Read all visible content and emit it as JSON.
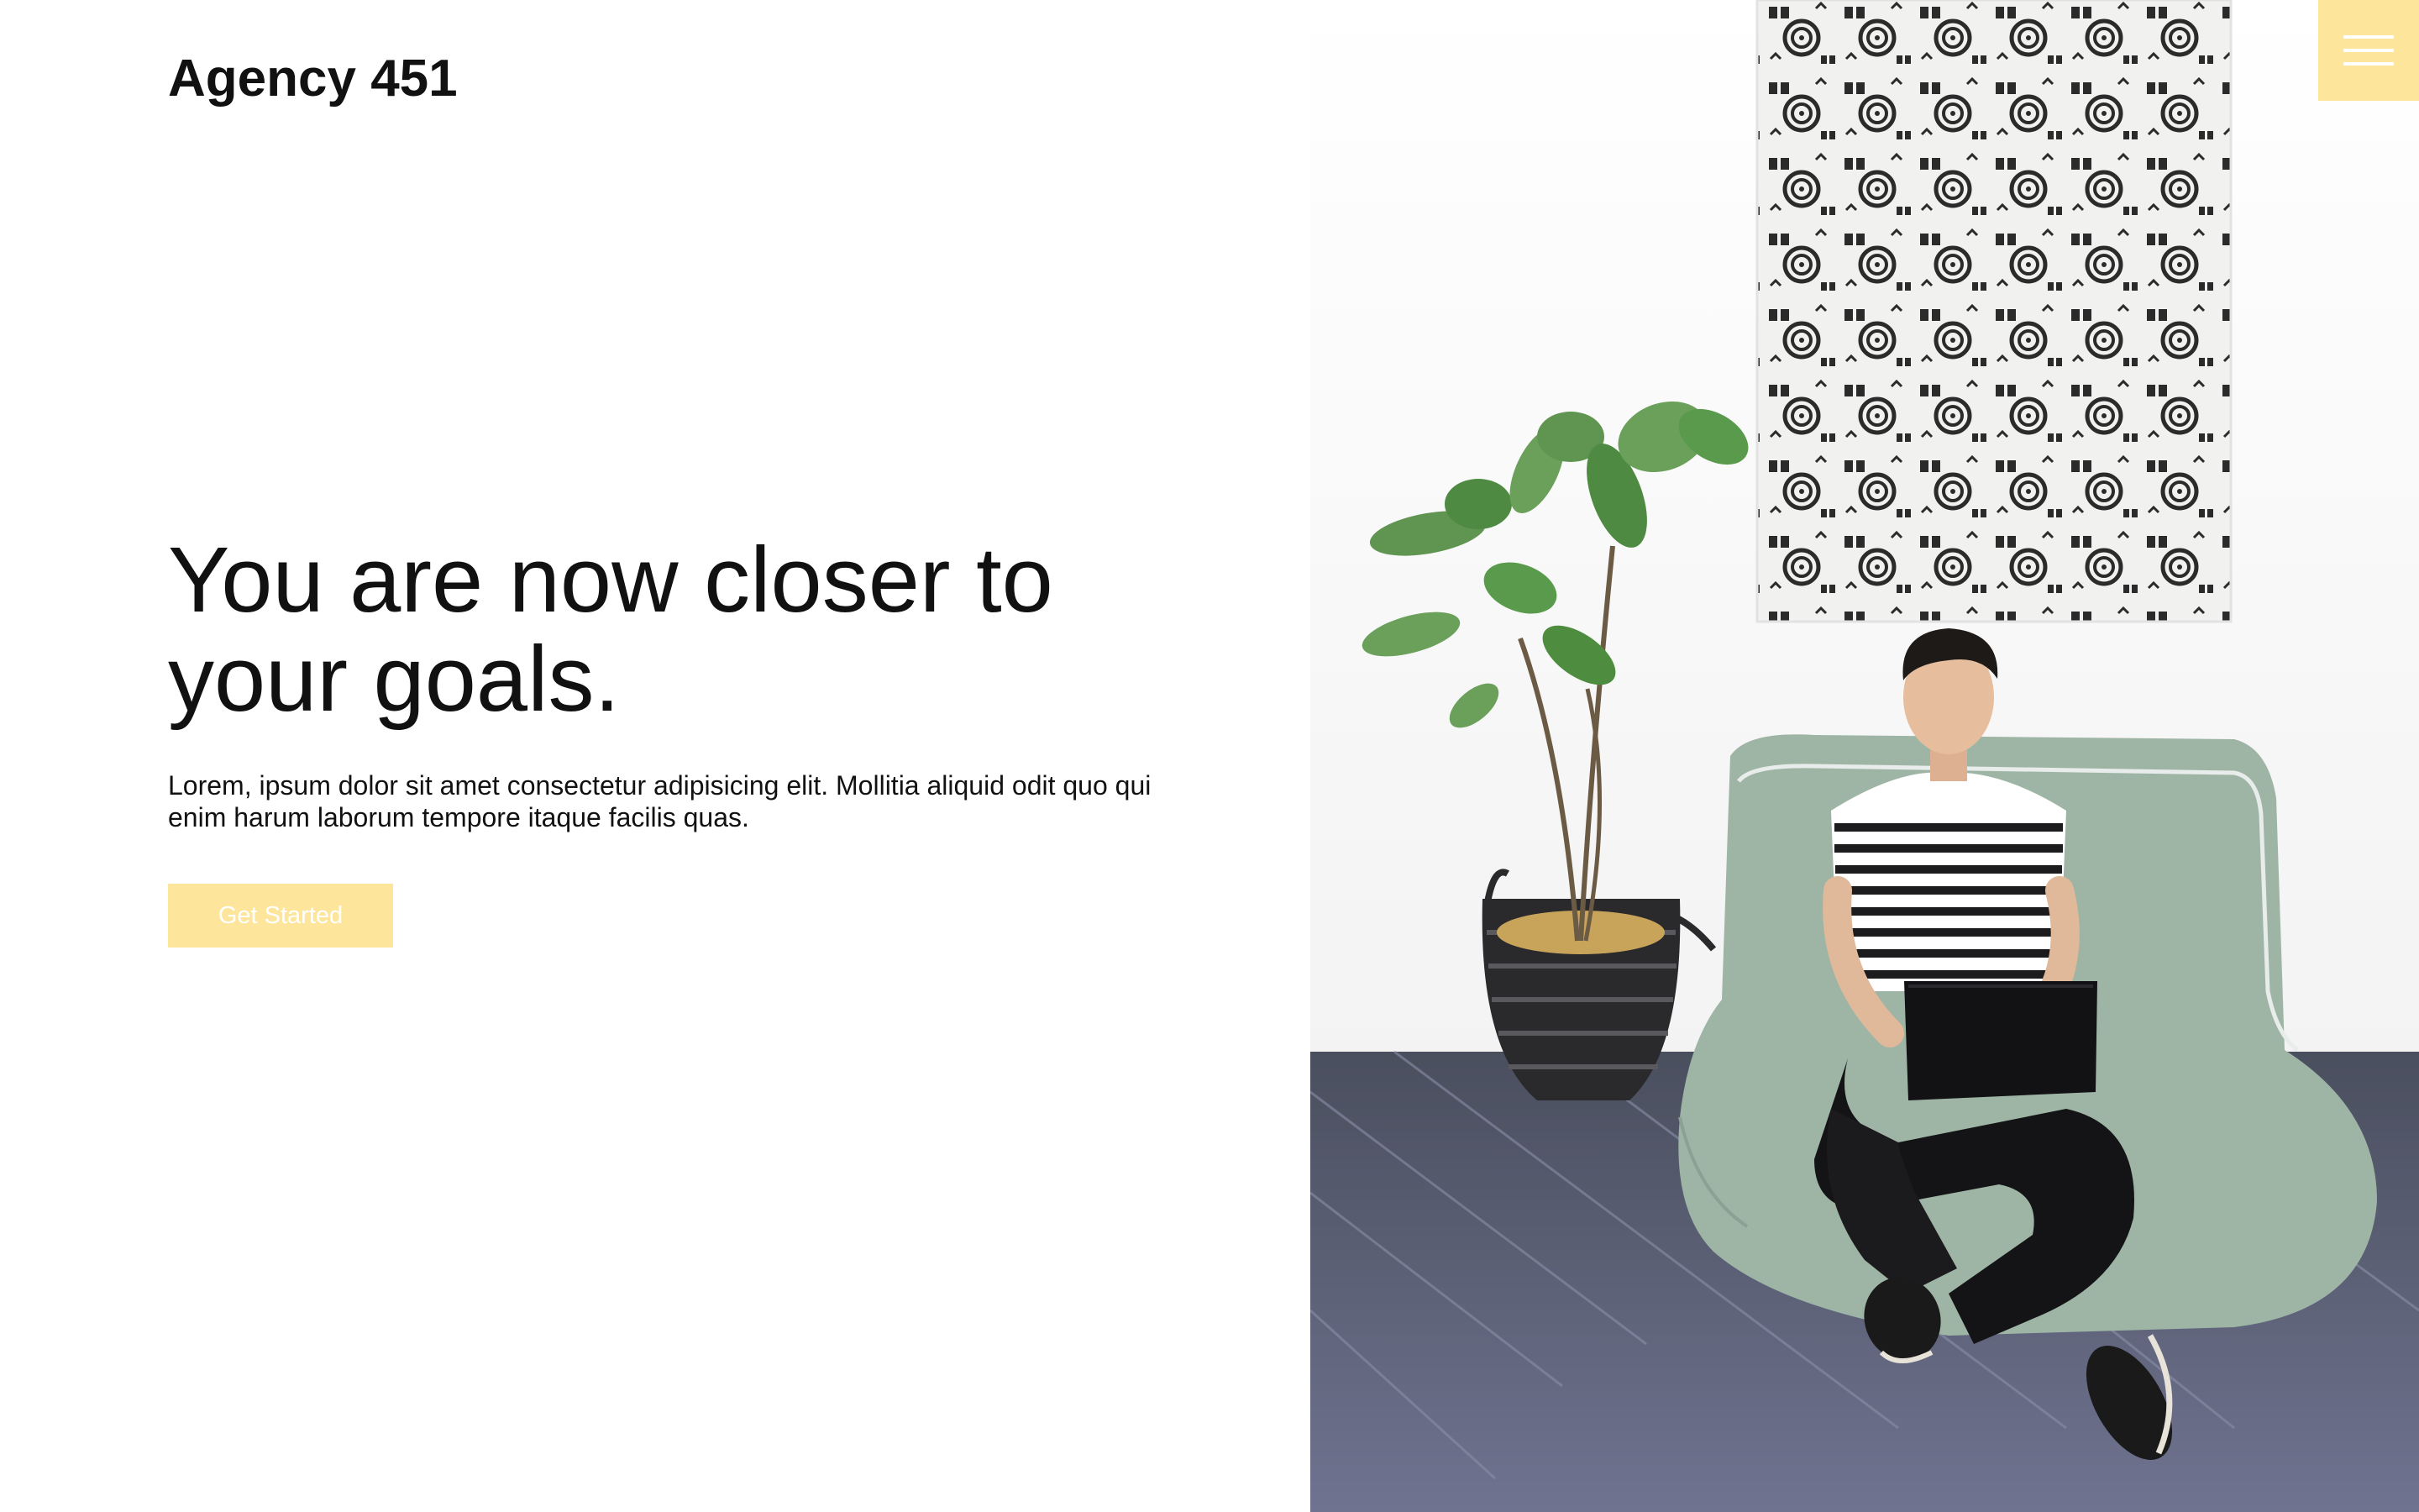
{
  "brand": {
    "name": "Agency 451"
  },
  "hero": {
    "title": "You are now closer to your goals.",
    "text": "Lorem, ipsum dolor sit amet consectetur adipisicing elit. Mollitia aliquid odit quo qui enim harum laborum tempore itaque facilis quas.",
    "cta_label": "Get Started"
  },
  "menu": {
    "icon": "hamburger-menu-icon"
  },
  "image": {
    "subject": "man with laptop on bean bag beside potted plant and patterned wall hanging"
  },
  "colors": {
    "accent": "#fde69c",
    "text": "#111111",
    "background": "#ffffff"
  }
}
